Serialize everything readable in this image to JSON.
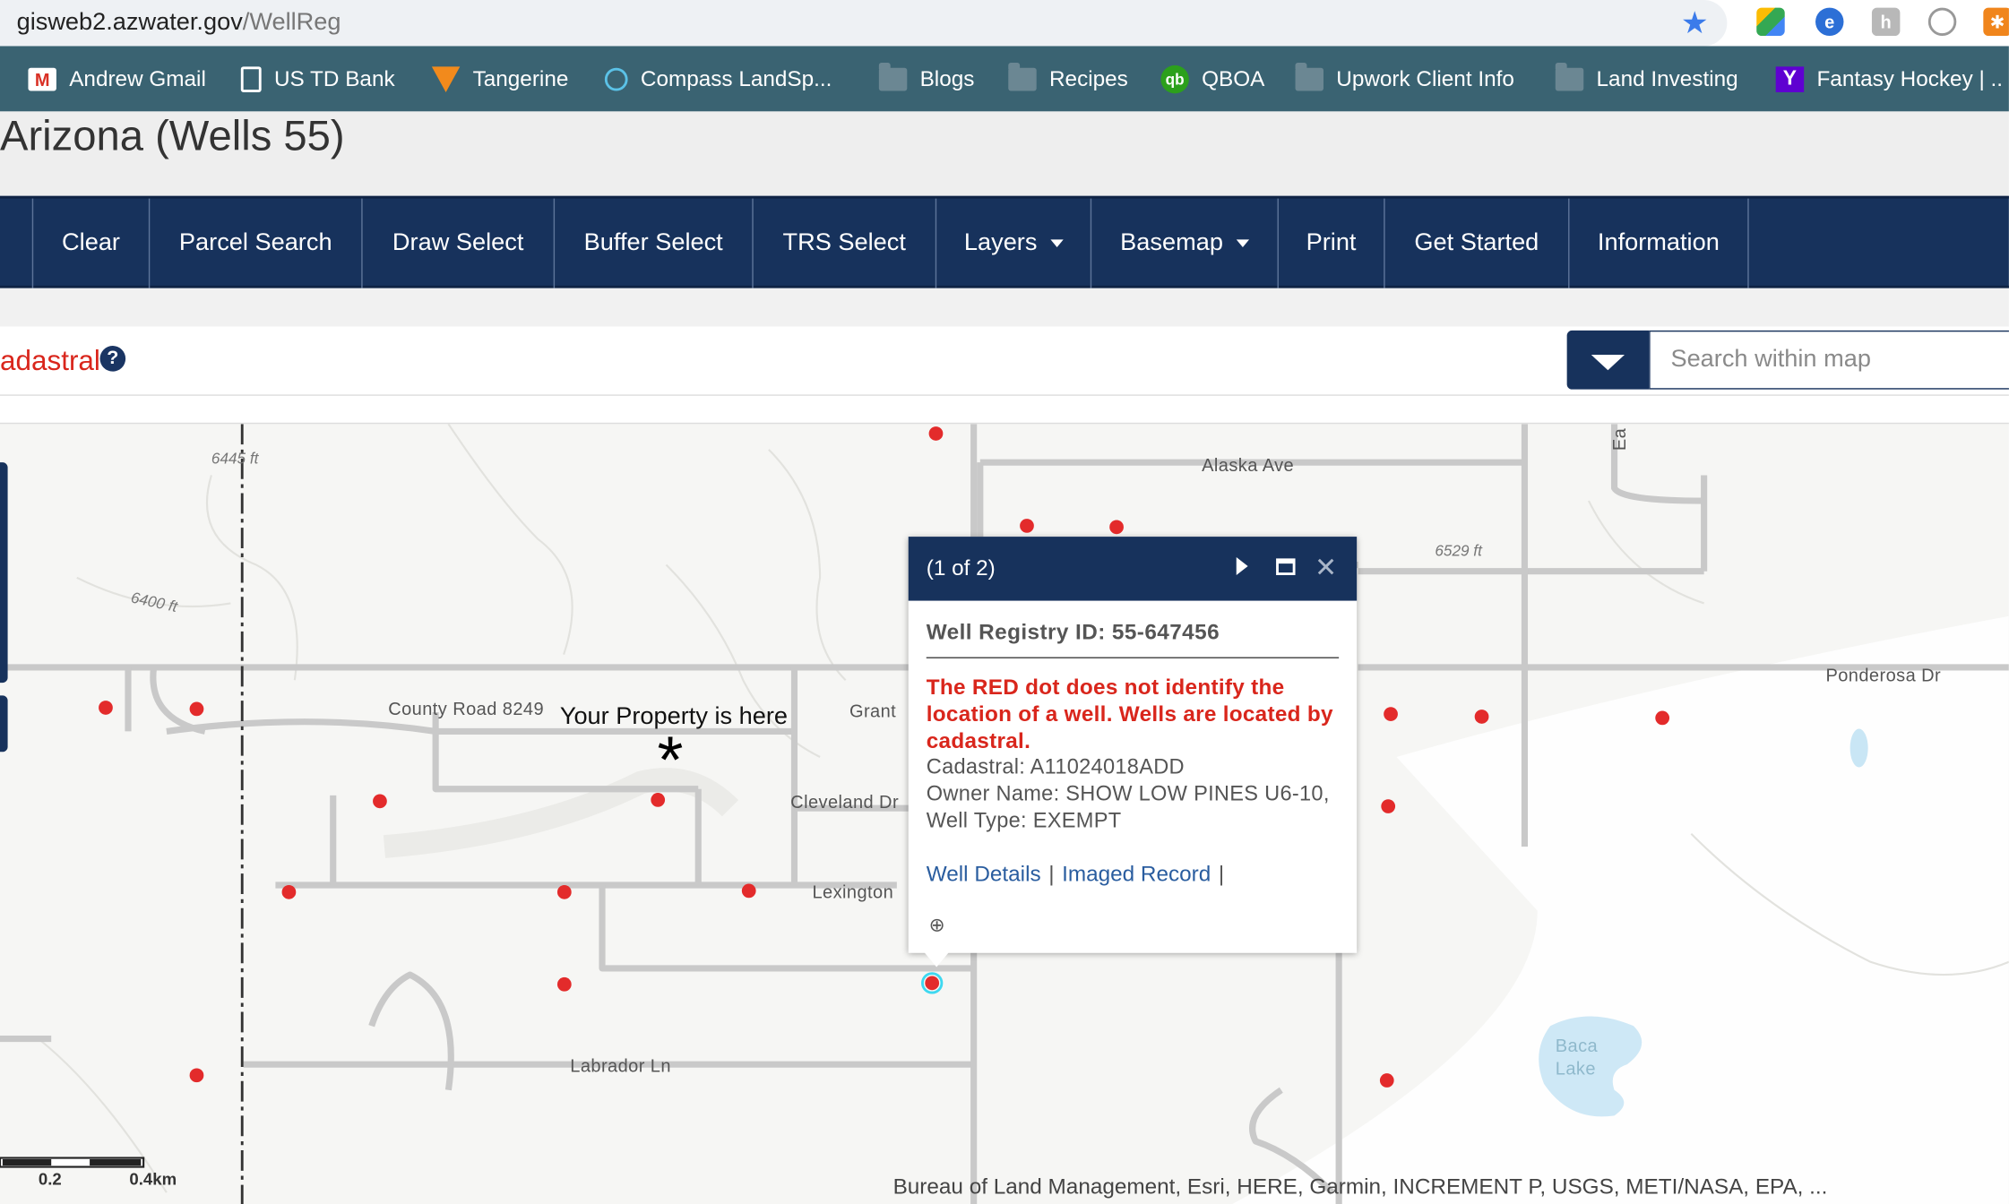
{
  "browser": {
    "url_host": "gisweb2.azwater.gov",
    "url_path": "/WellReg",
    "bookmarks": [
      {
        "label": "Andrew Gmail",
        "icon": "gmail-icon"
      },
      {
        "label": "US TD Bank",
        "icon": "page-icon"
      },
      {
        "label": "Tangerine",
        "icon": "tangerine-icon"
      },
      {
        "label": "Compass LandSp...",
        "icon": "compass-icon"
      },
      {
        "label": "Blogs",
        "icon": "folder-icon"
      },
      {
        "label": "Recipes",
        "icon": "folder-icon"
      },
      {
        "label": "QBOA",
        "icon": "quickbooks-icon"
      },
      {
        "label": "Upwork Client Info",
        "icon": "folder-icon"
      },
      {
        "label": "Land Investing",
        "icon": "folder-icon"
      },
      {
        "label": "Fantasy Hockey | ..",
        "icon": "yahoo-icon"
      }
    ]
  },
  "page": {
    "title": "Arizona (Wells 55)"
  },
  "nav": {
    "items": [
      {
        "label": "Clear"
      },
      {
        "label": "Parcel Search"
      },
      {
        "label": "Draw Select"
      },
      {
        "label": "Buffer Select"
      },
      {
        "label": "TRS Select"
      },
      {
        "label": "Layers"
      },
      {
        "label": "Basemap"
      },
      {
        "label": "Print"
      },
      {
        "label": "Get Started"
      },
      {
        "label": "Information"
      }
    ]
  },
  "search": {
    "layer_label": "adastral",
    "placeholder": "Search within map"
  },
  "map": {
    "streets": {
      "alaska": "Alaska Ave",
      "county_road": "County Road 8249",
      "grant": "Grant",
      "cleveland": "Cleveland Dr",
      "lexington": "Lexington",
      "labrador": "Labrador Ln",
      "ponderosa": "Ponderosa  Dr",
      "baca_lake": "Baca\nLake",
      "ea": "Ea"
    },
    "elevations": {
      "e1": "6445 ft",
      "e2": "6400 ft",
      "e3": "6529 ft"
    },
    "annotation": "Your Property is here",
    "scale_labels": [
      "0.2",
      "0.4km"
    ],
    "attribution": "Bureau of Land Management, Esri, HERE, Garmin, INCREMENT P, USGS, METI/NASA, EPA, ...",
    "colors": {
      "well_dot": "#e32b2b",
      "nav": "#17325c",
      "warning": "#d9261c"
    }
  },
  "popup": {
    "counter": "(1 of 2)",
    "title": "Well Registry ID: 55-647456",
    "warning": "The RED dot does not identify the location of a well. Wells are located by cadastral.",
    "cadastral": " Cadastral: A11024018ADD",
    "owner": "Owner Name: SHOW LOW PINES U6-10,",
    "well_type": "Well Type: EXEMPT",
    "link_details": "Well Details",
    "link_imaged": "Imaged Record",
    "sep": "|"
  }
}
